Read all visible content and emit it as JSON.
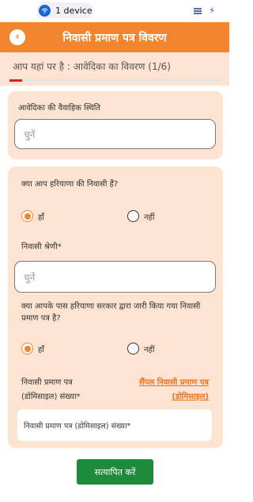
{
  "status_bar": {
    "device_label": "1 device"
  },
  "header": {
    "title": "निवासी प्रमाण पत्र विवरण"
  },
  "progress": {
    "text": "आप यहां पर है : आवेदिका का विवरण (1/6)",
    "fraction": 0.06
  },
  "section1": {
    "marital_label": "आवेदिका की वैवाहिक स्थिति",
    "marital_placeholder": "चुनें"
  },
  "section2": {
    "haryana_resident_question": "क्या आप हरियाणा की निवासी हैं?",
    "haryana_yes": "हाँ",
    "haryana_no": "नहीं",
    "category_label": "निवासी श्रेणी*",
    "category_placeholder": "चुनें",
    "certificate_question": "क्या आपके पास हरियाणा सरकार द्वारा जारी किया गया निवासी प्रमाण पत्र है?",
    "certificate_yes": "हाँ",
    "certificate_no": "नहीं",
    "domicile_number_label_line1": "निवासी प्रमाण पत्र",
    "domicile_number_label_line2": "(डोमिसाइल) संख्या*",
    "sample_link_line1": "सैंपल निवासी प्रमाण पत्र",
    "sample_link_line2": "(डोमिसाइल)",
    "domicile_number_placeholder": "निवासी प्रमाण पत्र (डोमिसाइल) संख्या*"
  },
  "verify_button": "सत्यापित करें",
  "colors": {
    "brand_orange": "#f1862e",
    "panel_peach": "#fde3d2",
    "verify_green": "#1e8a3b",
    "progress_red": "#d2232a"
  },
  "icons": {
    "wifi": "wifi-icon",
    "back": "back-arrow-icon",
    "flag": "flag-icon",
    "bolt": "charging-icon"
  }
}
